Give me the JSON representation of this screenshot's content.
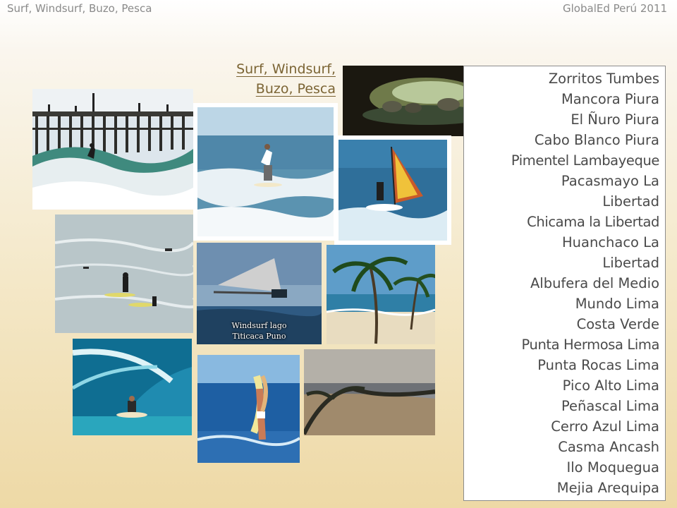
{
  "header": {
    "left": "Surf, Windsurf, Buzo, Pesca",
    "right": "GlobalEd Perú 2011"
  },
  "title": {
    "line1": "Surf, Windsurf,",
    "line2": "Buzo, Pesca"
  },
  "photos": {
    "windsurf_lago_caption_line1": "Windsurf lago",
    "windsurf_lago_caption_line2": "Titicaca Puno"
  },
  "locations": [
    "Zorritos Tumbes",
    "Mancora Piura",
    "El Ñuro Piura",
    "Cabo Blanco Piura",
    "Pimentel Lambayeque",
    "Pacasmayo La",
    "Libertad",
    "Chicama la Libertad",
    "Huanchaco La",
    "Libertad",
    "Albufera del Medio",
    "Mundo Lima",
    "Costa Verde",
    "Punta Hermosa Lima",
    "Punta Rocas Lima",
    "Pico Alto Lima",
    "Peñascal Lima",
    "Cerro Azul Lima",
    "Casma Ancash",
    "Ilo Moquegua",
    "Mejia Arequipa"
  ]
}
